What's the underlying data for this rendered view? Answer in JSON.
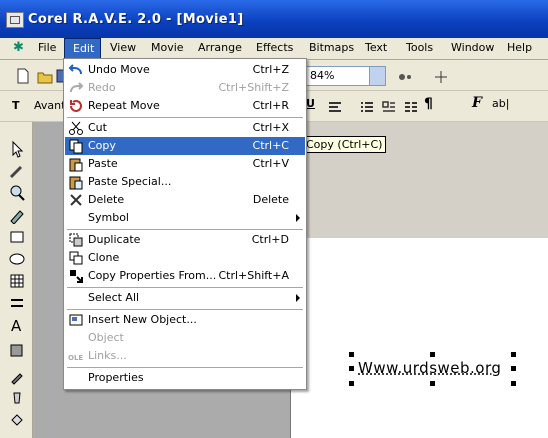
{
  "window": {
    "title": "Corel R.A.V.E. 2.0 - [Movie1]"
  },
  "menubar": {
    "items": [
      {
        "label": "File",
        "u": "F"
      },
      {
        "label": "Edit",
        "u": "E"
      },
      {
        "label": "View",
        "u": "V"
      },
      {
        "label": "Movie",
        "u": "M"
      },
      {
        "label": "Arrange",
        "u": "A"
      },
      {
        "label": "Effects",
        "u": "c"
      },
      {
        "label": "Bitmaps",
        "u": "B"
      },
      {
        "label": "Text",
        "u": "T"
      },
      {
        "label": "Tools",
        "u": "o"
      },
      {
        "label": "Window",
        "u": "W"
      },
      {
        "label": "Help",
        "u": "H"
      }
    ]
  },
  "toolbar": {
    "zoom_value": "84%",
    "font_name": "Avant"
  },
  "edit_menu": {
    "items": [
      {
        "label": "Undo Move",
        "shortcut": "Ctrl+Z",
        "icon": "undo-icon"
      },
      {
        "label": "Redo",
        "shortcut": "Ctrl+Shift+Z",
        "icon": "redo-icon",
        "disabled": true
      },
      {
        "label": "Repeat Move",
        "shortcut": "Ctrl+R",
        "icon": "repeat-icon"
      },
      {
        "label": "Cut",
        "shortcut": "Ctrl+X",
        "icon": "scissors-icon"
      },
      {
        "label": "Copy",
        "shortcut": "Ctrl+C",
        "icon": "copy-icon",
        "selected": true
      },
      {
        "label": "Paste",
        "shortcut": "Ctrl+V",
        "icon": "paste-icon"
      },
      {
        "label": "Paste Special...",
        "shortcut": "",
        "icon": "paste-special-icon"
      },
      {
        "label": "Delete",
        "shortcut": "Delete",
        "icon": "delete-icon"
      },
      {
        "label": "Symbol",
        "shortcut": "",
        "icon": "",
        "submenu": true
      },
      {
        "label": "Duplicate",
        "shortcut": "Ctrl+D",
        "icon": "duplicate-icon"
      },
      {
        "label": "Clone",
        "shortcut": "",
        "icon": "clone-icon"
      },
      {
        "label": "Copy Properties From...",
        "shortcut": "Ctrl+Shift+A",
        "icon": "copy-properties-icon"
      },
      {
        "label": "Select All",
        "shortcut": "",
        "icon": "",
        "submenu": true
      },
      {
        "label": "Insert New Object...",
        "shortcut": "",
        "icon": "insert-object-icon"
      },
      {
        "label": "Object",
        "shortcut": "",
        "icon": "",
        "disabled": true
      },
      {
        "label": "Links...",
        "shortcut": "",
        "icon": "ole-links-icon",
        "disabled": true
      },
      {
        "label": "Properties",
        "shortcut": "",
        "icon": ""
      }
    ]
  },
  "tooltip": {
    "text": "Copy (Ctrl+C)"
  },
  "canvas": {
    "text_object": "Www.urdsweb.org"
  }
}
